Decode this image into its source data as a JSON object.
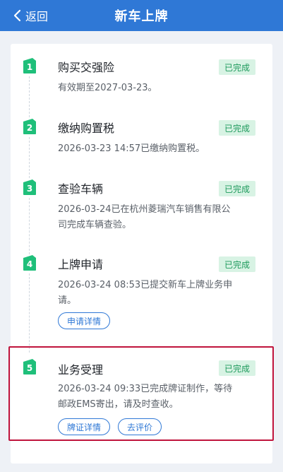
{
  "header": {
    "back_label": "返回",
    "title": "新车上牌"
  },
  "steps": [
    {
      "num": "1",
      "title": "购买交强险",
      "status": "已完成",
      "desc": "有效期至2027-03-23。"
    },
    {
      "num": "2",
      "title": "缴纳购置税",
      "status": "已完成",
      "desc": "2026-03-23 14:57已缴纳购置税。"
    },
    {
      "num": "3",
      "title": "查验车辆",
      "status": "已完成",
      "desc_lines": [
        "2026-03-24已在杭州菱瑞汽车销售有限公",
        "司完成车辆查验。"
      ]
    },
    {
      "num": "4",
      "title": "上牌申请",
      "status": "已完成",
      "desc_lines": [
        "2026-03-24 08:53已提交新车上牌业务申",
        "请。"
      ],
      "buttons": [
        "申请详情"
      ]
    },
    {
      "num": "5",
      "title": "业务受理",
      "status": "已完成",
      "desc_lines": [
        "2026-03-24 09:33已完成牌证制作，等待",
        "邮政EMS寄出，请及时查收。"
      ],
      "buttons": [
        "牌证详情",
        "去评价"
      ]
    }
  ],
  "colors": {
    "header_bg": "#2f78d6",
    "step_badge": "#1fbf7a",
    "status_bg": "#d8f3e4",
    "status_text": "#1e9a5c",
    "highlight_border": "#c0143c"
  }
}
